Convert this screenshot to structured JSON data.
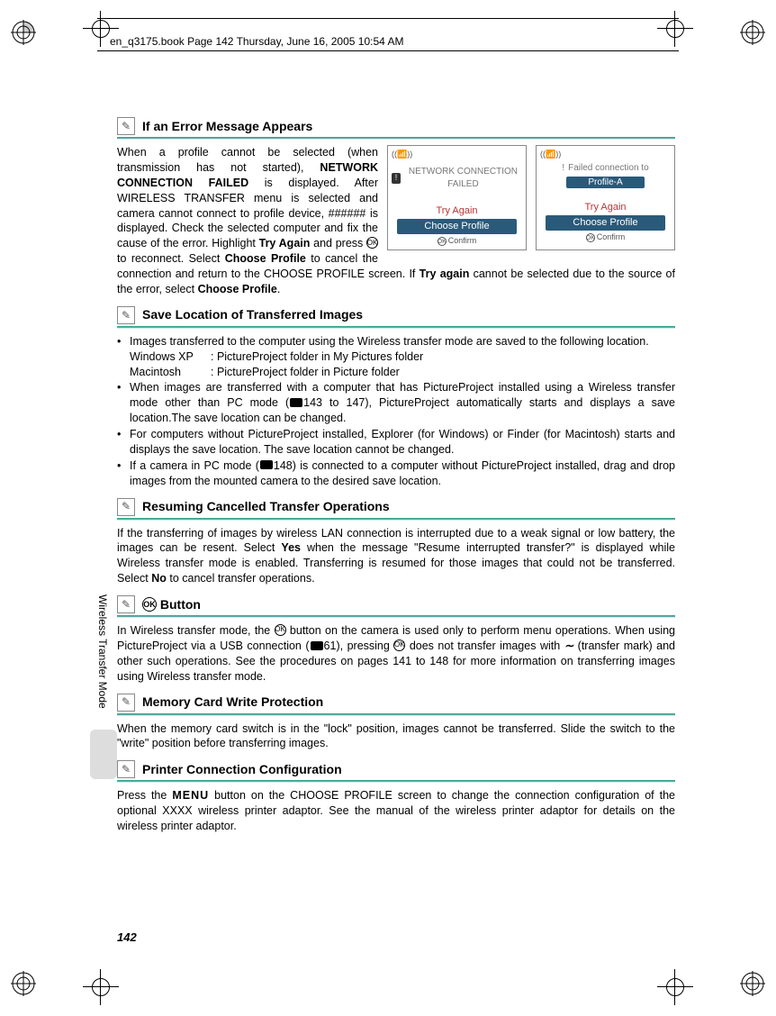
{
  "header": "en_q3175.book  Page 142  Thursday, June 16, 2005  10:54 AM",
  "side_label": "Wireless Transfer Mode",
  "page_number": "142",
  "sections": {
    "error": {
      "title": "If an Error Message Appears",
      "para1a": "When a profile cannot be selected (when transmission has not started), ",
      "bold1": "NETWORK CONNECTION FAILED",
      "para1b": " is displayed. After WIRELESS TRANSFER menu is selected and camera cannot connect to profile device, ###### is displayed. Check the selected computer and fix the cause of the error. Highlight ",
      "bold_try": "Try Again",
      "para2a": " and press ",
      "para2b": " to reconnect. Select ",
      "bold_choose": "Choose Profile",
      "para2c": " to cancel the connection and return to the CHOOSE PROFILE screen. If ",
      "bold_tryagain2": "Try again",
      "para2d": " cannot be selected due to the source of the error, select ",
      "bold_choose2": "Choose Profile",
      "para2e": "."
    },
    "lcd1": {
      "msg": "NETWORK CONNECTION FAILED",
      "try": "Try Again",
      "choose": "Choose Profile",
      "confirm": "Confirm"
    },
    "lcd2": {
      "msg_top": "Failed connection to",
      "profile": "Profile-A",
      "try": "Try Again",
      "choose": "Choose Profile",
      "confirm": "Confirm"
    },
    "save": {
      "title": "Save Location of Transferred Images",
      "b1": "Images transferred to the computer using the Wireless transfer mode are saved to the following location.",
      "winxp_k": "Windows XP",
      "winxp_v": ": PictureProject folder in My Pictures folder",
      "mac_k": "Macintosh",
      "mac_v": ": PictureProject folder in Picture folder",
      "b2a": "When images are transferred with a computer that has PictureProject installed using a Wireless transfer mode other than PC mode (",
      "b2b": "143 to 147), PictureProject automatically starts and displays a save location.The save location can be changed.",
      "b3": "For computers without PictureProject installed, Explorer (for Windows) or Finder (for Macintosh) starts and displays the save location. The save location cannot be changed.",
      "b4a": "If a camera in PC mode (",
      "b4b": "148) is connected to a computer without PictureProject installed, drag and drop images from the mounted camera to the desired save location."
    },
    "resume": {
      "title": "Resuming Cancelled Transfer Operations",
      "p1a": "If the transferring of images by wireless LAN connection is interrupted due to a weak signal or low battery, the images can be resent. Select ",
      "yes": "Yes",
      "p1b": " when the message \"Resume interrupted transfer?\" is displayed while Wireless transfer mode is enabled. Transferring is resumed for those images that could not be transferred. Select ",
      "no": "No",
      "p1c": " to cancel transfer operations."
    },
    "okbtn": {
      "title": " Button",
      "p1a": "In Wireless transfer mode, the ",
      "p1b": " button on the camera is used only to perform menu operations. When using PictureProject via a USB connection (",
      "p1c": "61), pressing ",
      "p1d": " does not transfer images with ",
      "p1e": " (transfer mark) and other such operations. See the procedures on pages 141 to 148 for more information on transferring images using Wireless transfer mode."
    },
    "memcard": {
      "title": "Memory Card Write Protection",
      "p": "When the memory card switch is in the \"lock\" position, images cannot be transferred. Slide the switch to the \"write\" position before transferring images."
    },
    "printer": {
      "title": "Printer Connection Configuration",
      "p1a": "Press the ",
      "menu": "MENU",
      "p1b": " button on the CHOOSE PROFILE screen to change the connection configuration of the optional XXXX wireless printer adaptor. See the manual of the wireless printer adaptor for details on the wireless printer adaptor."
    }
  }
}
